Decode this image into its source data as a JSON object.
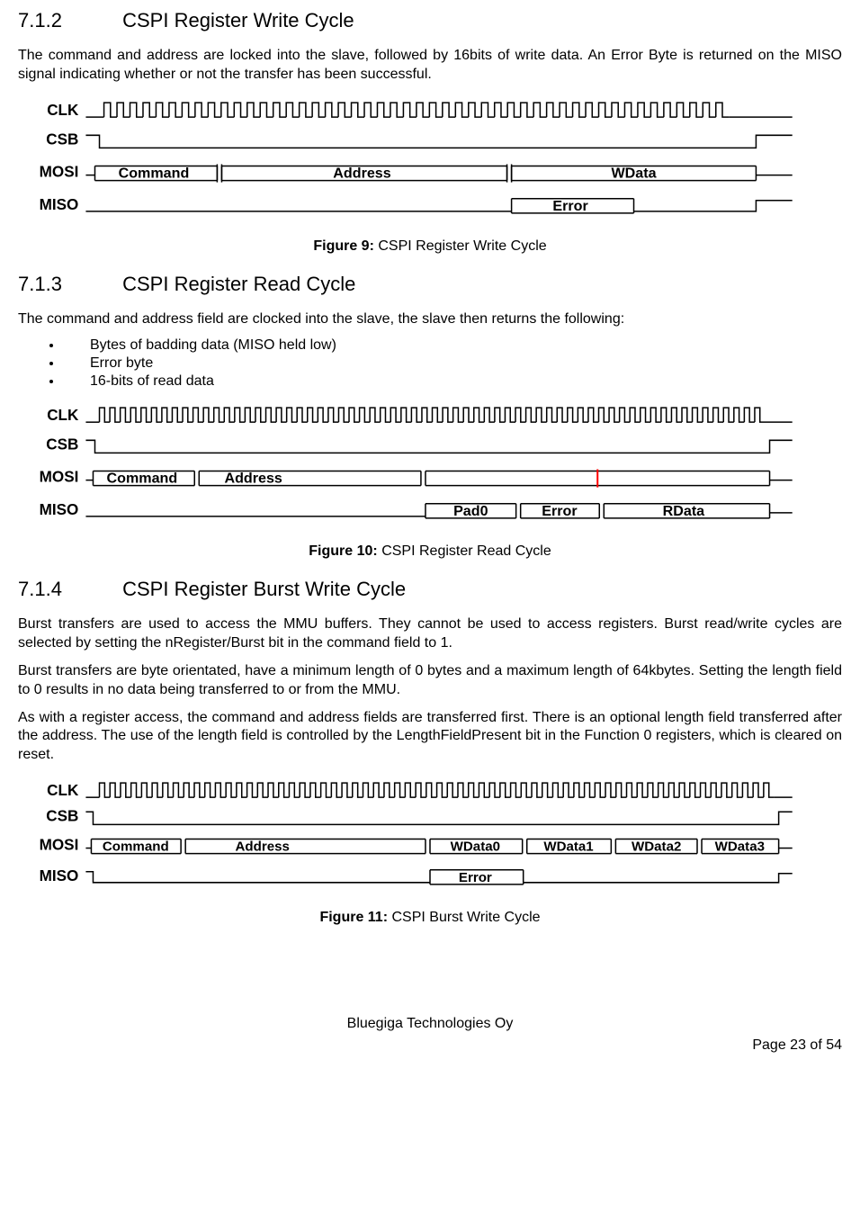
{
  "section_712": {
    "number": "7.1.2",
    "title": "CSPI Register Write Cycle",
    "para": "The command and address are locked into the slave, followed by 16bits of write data. An Error Byte is returned on the MISO signal indicating whether or not the transfer has been successful."
  },
  "fig9": {
    "caption_bold": "Figure 9:",
    "caption_text": " CSPI Register Write Cycle",
    "signals": {
      "clk": "CLK",
      "csb": "CSB",
      "mosi": "MOSI",
      "miso": "MISO",
      "command": "Command",
      "address": "Address",
      "wdata": "WData",
      "error": "Error"
    }
  },
  "section_713": {
    "number": "7.1.3",
    "title": "CSPI Register Read Cycle",
    "para": "The command and address field are clocked into the slave, the slave then returns the following:",
    "bullets": [
      "Bytes of badding data (MISO held low)",
      "Error byte",
      "16-bits of read data"
    ]
  },
  "fig10": {
    "caption_bold": "Figure 10:",
    "caption_text": " CSPI Register Read Cycle",
    "signals": {
      "clk": "CLK",
      "csb": "CSB",
      "mosi": "MOSI",
      "miso": "MISO",
      "command": "Command",
      "address": "Address",
      "pad0": "Pad0",
      "error": "Error",
      "rdata": "RData"
    }
  },
  "section_714": {
    "number": "7.1.4",
    "title": "CSPI Register Burst Write Cycle",
    "para1": "Burst transfers are used to access the MMU buffers. They cannot be used to access registers. Burst read/write cycles are selected by setting the nRegister/Burst bit in the command field to 1.",
    "para2": "Burst transfers are byte orientated, have a minimum length of 0 bytes and a maximum length of 64kbytes. Setting the length field to 0 results in no data being transferred to or from the MMU.",
    "para3": "As with a register access, the command and address fields are transferred first. There is an optional length field transferred after the address. The use of the length field is controlled by the LengthFieldPresent bit in the Function 0 registers, which is cleared on reset."
  },
  "fig11": {
    "caption_bold": "Figure 11:",
    "caption_text": " CSPI Burst Write Cycle",
    "signals": {
      "clk": "CLK",
      "csb": "CSB",
      "mosi": "MOSI",
      "miso": "MISO",
      "command": "Command",
      "address": "Address",
      "wdata0": "WData0",
      "wdata1": "WData1",
      "wdata2": "WData2",
      "wdata3": "WData3",
      "error": "Error"
    }
  },
  "footer": {
    "company": "Bluegiga Technologies Oy",
    "page": "Page 23 of 54"
  }
}
